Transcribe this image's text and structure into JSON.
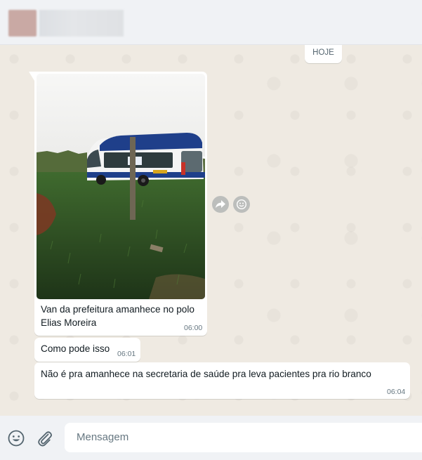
{
  "header": {
    "contact_avatar": "blurred-avatar",
    "contact_name": ""
  },
  "chat": {
    "date_label": "HOJE",
    "messages": [
      {
        "type": "image",
        "caption_line1": "Van da prefeitura amanhece no polo",
        "caption_line2": "Elias Moreira",
        "time": "06:00"
      },
      {
        "type": "text",
        "text": "Como pode isso",
        "time": "06:01"
      },
      {
        "type": "text",
        "text": "Não é pra amanhece na secretaria de saúde  pra leva pacientes pra rio branco",
        "time": "06:04"
      }
    ],
    "actions": {
      "forward_icon": "forward-icon",
      "react_icon": "emoji-react-icon"
    }
  },
  "footer": {
    "emoji_icon": "emoji-icon",
    "attach_icon": "paperclip-icon",
    "input_placeholder": "Mensagem"
  },
  "colors": {
    "chat_background": "#efeae2",
    "bubble_background": "#ffffff",
    "panel_background": "#f0f2f5",
    "meta_text": "#667781"
  }
}
